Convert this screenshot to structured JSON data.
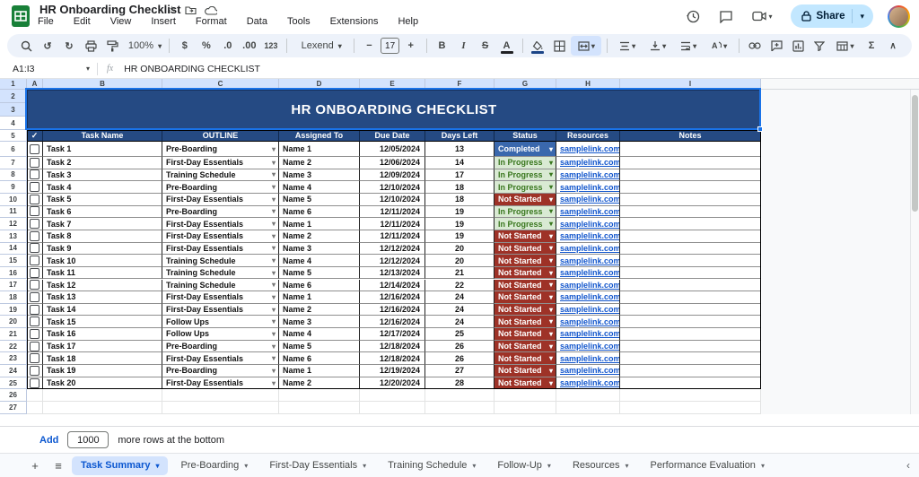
{
  "window": {
    "title": "HR Onboarding Checklist"
  },
  "menu": {
    "items": [
      "File",
      "Edit",
      "View",
      "Insert",
      "Format",
      "Data",
      "Tools",
      "Extensions",
      "Help"
    ]
  },
  "topbar_right": {
    "share_label": "Share"
  },
  "toolbar": {
    "zoom": "100%",
    "font": "Lexend",
    "font_size": "17",
    "glyphs": {
      "undo": "↺",
      "redo": "↻",
      "dollar": "$",
      "percent": "%",
      "dec_dec": ".0",
      "dec_inc": ".00",
      "num_123": "123",
      "minus": "−",
      "plus": "+",
      "bold": "B",
      "italic": "I",
      "strike": "S",
      "text_color": "A",
      "sigma": "Σ",
      "caret": "▾",
      "collapse": "∧"
    }
  },
  "formula_bar": {
    "name_box": "A1:I3",
    "fx_label": "fx",
    "value": "HR ONBOARDING CHECKLIST"
  },
  "grid": {
    "column_letters": [
      "A",
      "B",
      "C",
      "D",
      "E",
      "F",
      "G",
      "H",
      "I"
    ],
    "row_count": 27,
    "selected_range_rows": 3,
    "title_banner": "HR ONBOARDING CHECKLIST"
  },
  "table": {
    "headers": {
      "check": "✓",
      "task": "Task Name",
      "outline": "OUTLINE",
      "assigned": "Assigned To",
      "due": "Due Date",
      "days": "Days Left",
      "status": "Status",
      "resources": "Resources",
      "notes": "Notes"
    },
    "rows": [
      {
        "task": "Task 1",
        "outline": "Pre-Boarding",
        "assigned": "Name 1",
        "due": "12/05/2024",
        "days": "13",
        "status": "Completed",
        "resource": "samplelink.com",
        "note": ""
      },
      {
        "task": "Task 2",
        "outline": "First-Day Essentials",
        "assigned": "Name 2",
        "due": "12/06/2024",
        "days": "14",
        "status": "In Progress",
        "resource": "samplelink.com",
        "note": ""
      },
      {
        "task": "Task 3",
        "outline": "Training Schedule",
        "assigned": "Name 3",
        "due": "12/09/2024",
        "days": "17",
        "status": "In Progress",
        "resource": "samplelink.com",
        "note": ""
      },
      {
        "task": "Task 4",
        "outline": "Pre-Boarding",
        "assigned": "Name 4",
        "due": "12/10/2024",
        "days": "18",
        "status": "In Progress",
        "resource": "samplelink.com",
        "note": ""
      },
      {
        "task": "Task 5",
        "outline": "First-Day Essentials",
        "assigned": "Name 5",
        "due": "12/10/2024",
        "days": "18",
        "status": "Not Started",
        "resource": "samplelink.com",
        "note": ""
      },
      {
        "task": "Task 6",
        "outline": "Pre-Boarding",
        "assigned": "Name 6",
        "due": "12/11/2024",
        "days": "19",
        "status": "In Progress",
        "resource": "samplelink.com",
        "note": ""
      },
      {
        "task": "Task 7",
        "outline": "First-Day Essentials",
        "assigned": "Name 1",
        "due": "12/11/2024",
        "days": "19",
        "status": "In Progress",
        "resource": "samplelink.com",
        "note": ""
      },
      {
        "task": "Task 8",
        "outline": "First-Day Essentials",
        "assigned": "Name 2",
        "due": "12/11/2024",
        "days": "19",
        "status": "Not Started",
        "resource": "samplelink.com",
        "note": ""
      },
      {
        "task": "Task 9",
        "outline": "First-Day Essentials",
        "assigned": "Name 3",
        "due": "12/12/2024",
        "days": "20",
        "status": "Not Started",
        "resource": "samplelink.com",
        "note": ""
      },
      {
        "task": "Task 10",
        "outline": "Training Schedule",
        "assigned": "Name 4",
        "due": "12/12/2024",
        "days": "20",
        "status": "Not Started",
        "resource": "samplelink.com",
        "note": ""
      },
      {
        "task": "Task 11",
        "outline": "Training Schedule",
        "assigned": "Name 5",
        "due": "12/13/2024",
        "days": "21",
        "status": "Not Started",
        "resource": "samplelink.com",
        "note": ""
      },
      {
        "task": "Task 12",
        "outline": "Training Schedule",
        "assigned": "Name 6",
        "due": "12/14/2024",
        "days": "22",
        "status": "Not Started",
        "resource": "samplelink.com",
        "note": ""
      },
      {
        "task": "Task 13",
        "outline": "First-Day Essentials",
        "assigned": "Name 1",
        "due": "12/16/2024",
        "days": "24",
        "status": "Not Started",
        "resource": "samplelink.com",
        "note": ""
      },
      {
        "task": "Task 14",
        "outline": "First-Day Essentials",
        "assigned": "Name 2",
        "due": "12/16/2024",
        "days": "24",
        "status": "Not Started",
        "resource": "samplelink.com",
        "note": ""
      },
      {
        "task": "Task 15",
        "outline": "Follow Ups",
        "assigned": "Name 3",
        "due": "12/16/2024",
        "days": "24",
        "status": "Not Started",
        "resource": "samplelink.com",
        "note": ""
      },
      {
        "task": "Task 16",
        "outline": "Follow Ups",
        "assigned": "Name 4",
        "due": "12/17/2024",
        "days": "25",
        "status": "Not Started",
        "resource": "samplelink.com",
        "note": ""
      },
      {
        "task": "Task 17",
        "outline": "Pre-Boarding",
        "assigned": "Name 5",
        "due": "12/18/2024",
        "days": "26",
        "status": "Not Started",
        "resource": "samplelink.com",
        "note": ""
      },
      {
        "task": "Task 18",
        "outline": "First-Day Essentials",
        "assigned": "Name 6",
        "due": "12/18/2024",
        "days": "26",
        "status": "Not Started",
        "resource": "samplelink.com",
        "note": ""
      },
      {
        "task": "Task 19",
        "outline": "Pre-Boarding",
        "assigned": "Name 1",
        "due": "12/19/2024",
        "days": "27",
        "status": "Not Started",
        "resource": "samplelink.com",
        "note": ""
      },
      {
        "task": "Task 20",
        "outline": "First-Day Essentials",
        "assigned": "Name 2",
        "due": "12/20/2024",
        "days": "28",
        "status": "Not Started",
        "resource": "samplelink.com",
        "note": ""
      }
    ]
  },
  "status_styles": {
    "Completed": {
      "bg": "#3a68ad",
      "fg": "#ffffff",
      "caret": "#ffffff"
    },
    "In Progress": {
      "bg": "#d9ead3",
      "fg": "#38761d",
      "caret": "#38761d"
    },
    "Not Started": {
      "bg": "#9e3227",
      "fg": "#ffffff",
      "caret": "#ffffff"
    }
  },
  "colors": {
    "banner": "#254a83",
    "header_row": "#254a83",
    "link": "#1155cc",
    "selection": "#1a73e8",
    "accent": "#0b57d0"
  },
  "footer": {
    "add_label": "Add",
    "rows_value": "1000",
    "suffix": "more rows at the bottom"
  },
  "sheet_tabs": {
    "active": "Task Summary",
    "items": [
      "Task Summary",
      "Pre-Boarding",
      "First-Day Essentials",
      "Training Schedule",
      "Follow-Up",
      "Resources",
      "Performance Evaluation"
    ]
  }
}
